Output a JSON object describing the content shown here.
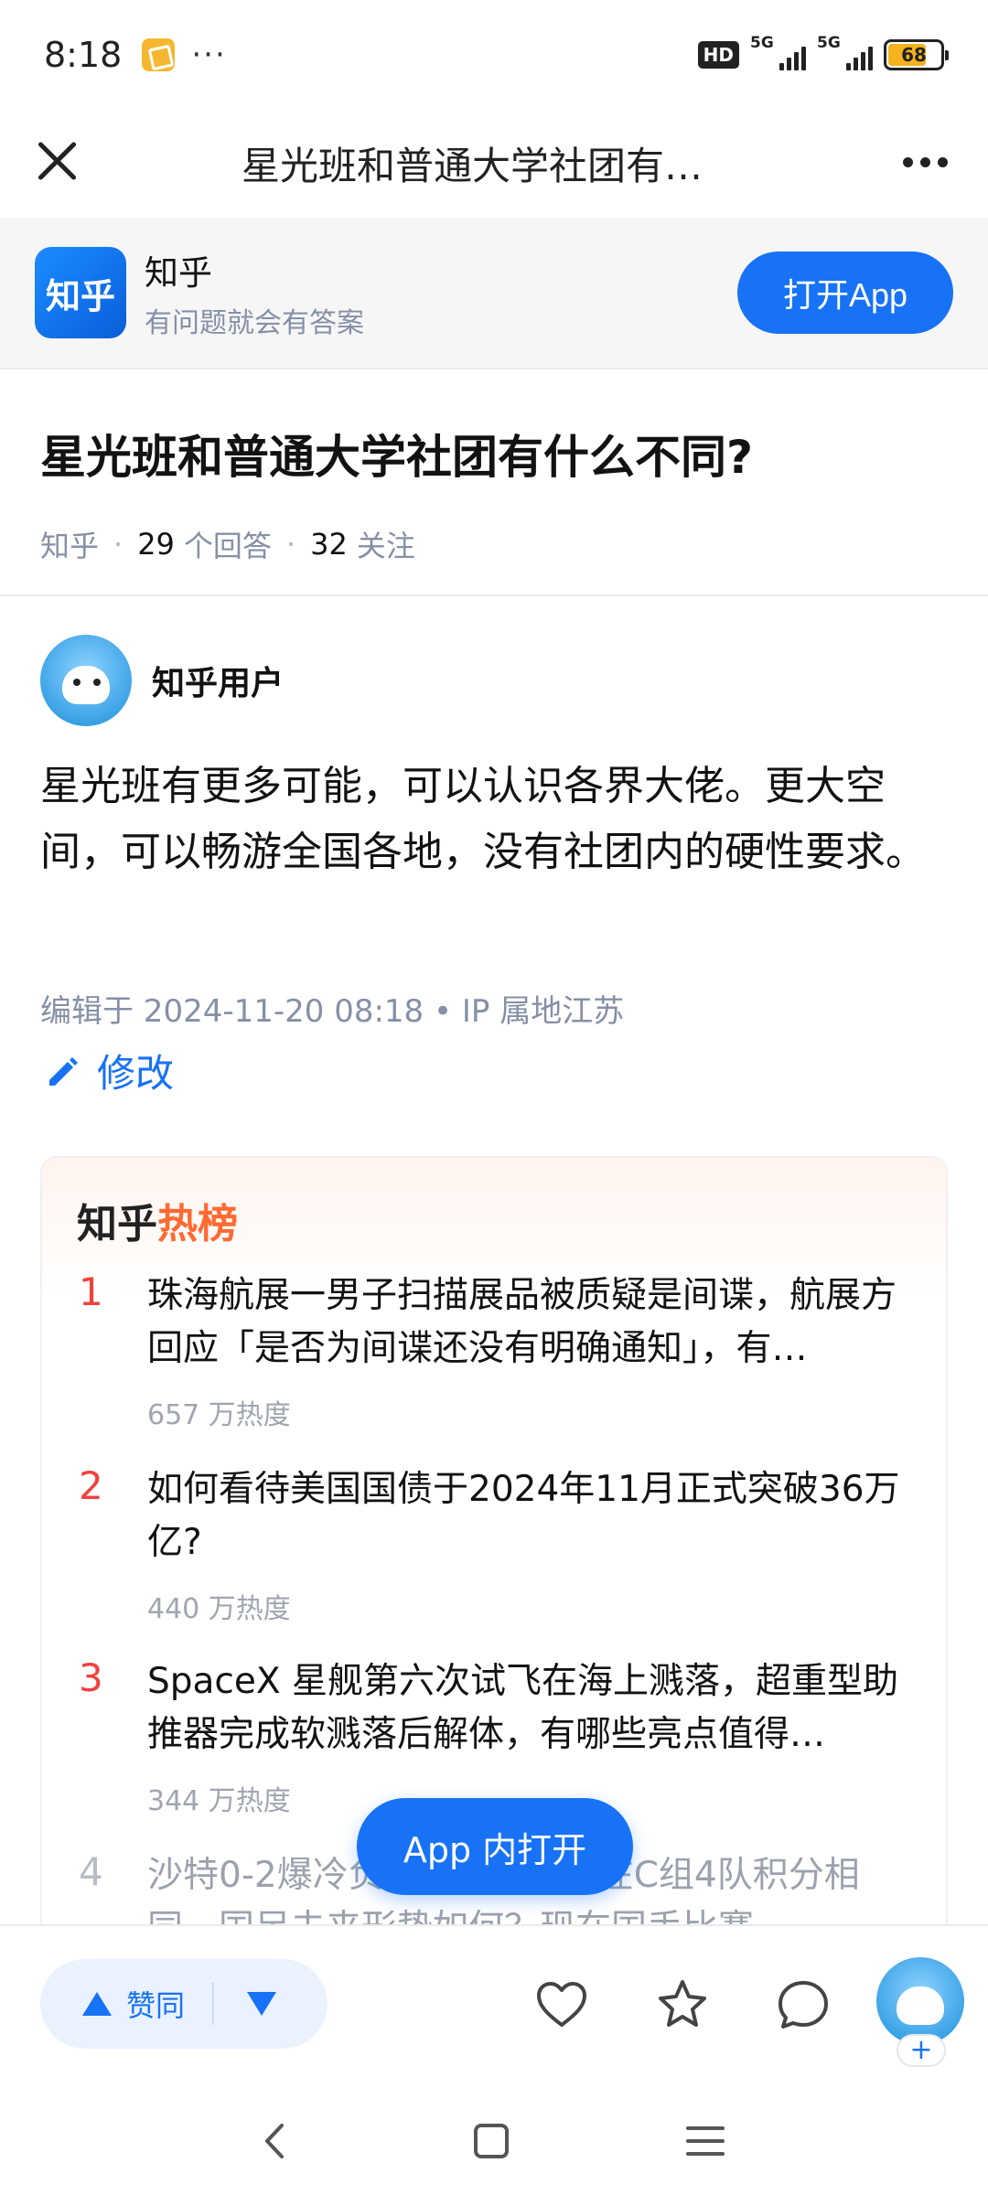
{
  "status_bar": {
    "time": "8:18",
    "more": "···",
    "hd": "HD",
    "sim1": "5G",
    "sim2": "5G",
    "battery": "68"
  },
  "top_bar": {
    "title": "星光班和普通大学社团有…"
  },
  "app_banner": {
    "logo": "知乎",
    "name": "知乎",
    "slogan": "有问题就会有答案",
    "open_label": "打开App"
  },
  "question": {
    "title": "星光班和普通大学社团有什么不同?",
    "source": "知乎",
    "answer_count": "29",
    "answer_unit": "个回答",
    "follow_count": "32",
    "follow_unit": "关注"
  },
  "answer": {
    "author": "知乎用户",
    "body": "星光班有更多可能，可以认识各界大佬。更大空间，可以畅游全国各地，没有社团内的硬性要求。",
    "edit_meta": "编辑于 2024-11-20 08:18 • IP 属地江苏",
    "modify_label": "修改"
  },
  "hot_list": {
    "title_main": "知乎",
    "title_accent": "热榜",
    "items": [
      {
        "rank": "1",
        "title": "珠海航展一男子扫描展品被质疑是间谍，航展方回应「是否为间谍还没有明确通知」，有…",
        "heat": "657 万热度"
      },
      {
        "rank": "2",
        "title": "如何看待美国国债于2024年11月正式突破36万亿?",
        "heat": "440 万热度"
      },
      {
        "rank": "3",
        "title": "SpaceX 星舰第六次试飞在海上溅落，超重型助推器完成软溅落后解体，有哪些亮点值得…",
        "heat": "344 万热度"
      },
      {
        "rank": "4",
        "title": "沙特0-2爆冷负印尼，国足所在C组4队积分相同，国足未来形势如何？现在国手比赛…",
        "heat": ""
      }
    ]
  },
  "float_button": {
    "label": "App 内打开"
  },
  "bottom_bar": {
    "upvote_label": "赞同",
    "plus": "+"
  },
  "colors": {
    "brand_blue": "#1772f6",
    "hot_red": "#f1403c",
    "hot_accent": "#ff6a32",
    "meta_gray": "#8590a6"
  },
  "icons": [
    "close-icon",
    "more-icon",
    "pencil-icon",
    "upvote-icon",
    "downvote-icon",
    "heart-icon",
    "star-icon",
    "comment-icon",
    "back-nav-icon",
    "home-nav-icon",
    "menu-nav-icon"
  ]
}
